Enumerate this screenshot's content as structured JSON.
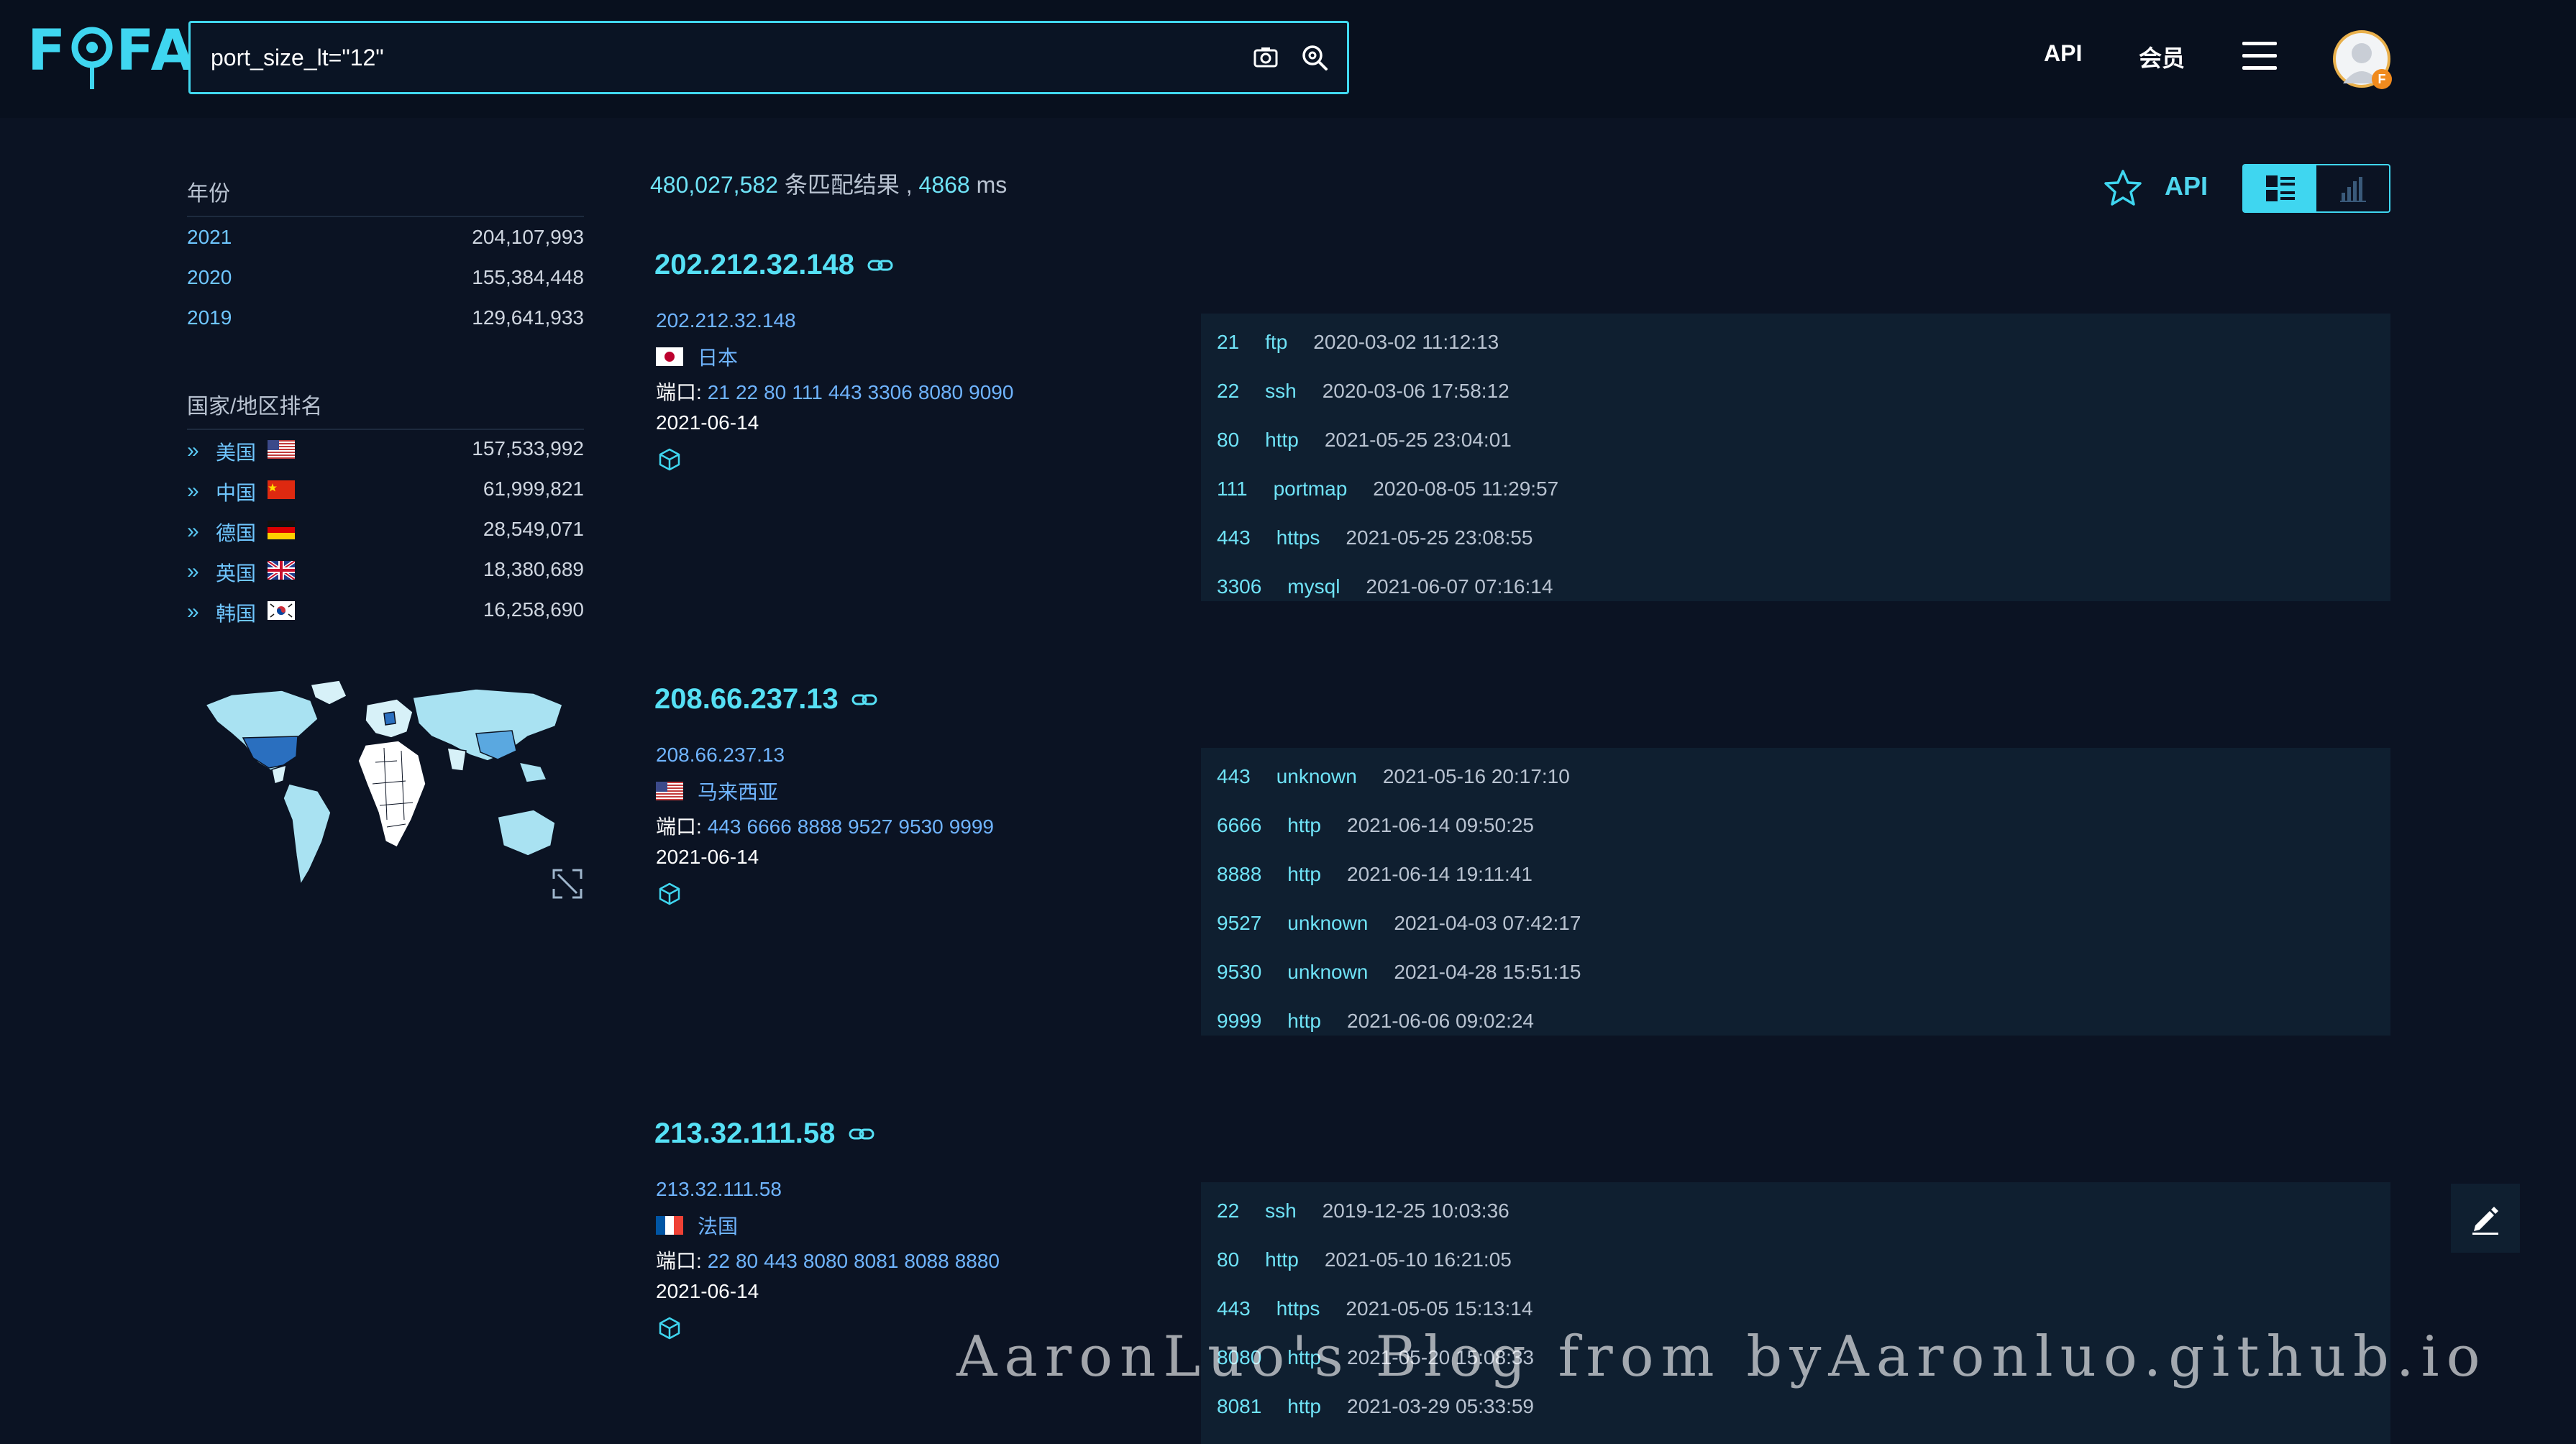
{
  "header": {
    "logo_text": "FOFA",
    "search_value": "port_size_lt=\"12\"",
    "nav_api": "API",
    "nav_member": "会员",
    "avatar_badge": "F"
  },
  "sidebar": {
    "year_heading": "年份",
    "years": [
      {
        "label": "2021",
        "count": "204,107,993"
      },
      {
        "label": "2020",
        "count": "155,384,448"
      },
      {
        "label": "2019",
        "count": "129,641,933"
      }
    ],
    "country_heading": "国家/地区排名",
    "countries": [
      {
        "label": "美国",
        "flag": "us-flag",
        "count": "157,533,992"
      },
      {
        "label": "中国",
        "flag": "cn-flag",
        "count": "61,999,821"
      },
      {
        "label": "德国",
        "flag": "de-flag",
        "count": "28,549,071"
      },
      {
        "label": "英国",
        "flag": "gb-flag",
        "count": "18,380,689"
      },
      {
        "label": "韩国",
        "flag": "kr-flag",
        "count": "16,258,690"
      }
    ]
  },
  "summary": {
    "count": "480,027,582",
    "count_suffix": " 条匹配结果 , ",
    "time": "4868",
    "time_unit": " ms"
  },
  "toolbar": {
    "api_label": "API"
  },
  "results": [
    {
      "title": "202.212.32.148",
      "ip": "202.212.32.148",
      "country": "日本",
      "flag": "jp-flag",
      "ports_label": "端口:",
      "ports": [
        "21",
        "22",
        "80",
        "111",
        "443",
        "3306",
        "8080",
        "9090"
      ],
      "date": "2021-06-14",
      "services": [
        {
          "port": "21",
          "protocol": "ftp",
          "time": "2020-03-02 11:12:13"
        },
        {
          "port": "22",
          "protocol": "ssh",
          "time": "2020-03-06 17:58:12"
        },
        {
          "port": "80",
          "protocol": "http",
          "time": "2021-05-25 23:04:01"
        },
        {
          "port": "111",
          "protocol": "portmap",
          "time": "2020-08-05 11:29:57"
        },
        {
          "port": "443",
          "protocol": "https",
          "time": "2021-05-25 23:08:55"
        },
        {
          "port": "3306",
          "protocol": "mysql",
          "time": "2021-06-07 07:16:14"
        }
      ]
    },
    {
      "title": "208.66.237.13",
      "ip": "208.66.237.13",
      "country": "马来西亚",
      "flag": "us-flag",
      "ports_label": "端口:",
      "ports": [
        "443",
        "6666",
        "8888",
        "9527",
        "9530",
        "9999"
      ],
      "date": "2021-06-14",
      "services": [
        {
          "port": "443",
          "protocol": "unknown",
          "time": "2021-05-16 20:17:10"
        },
        {
          "port": "6666",
          "protocol": "http",
          "time": "2021-06-14 09:50:25"
        },
        {
          "port": "8888",
          "protocol": "http",
          "time": "2021-06-14 19:11:41"
        },
        {
          "port": "9527",
          "protocol": "unknown",
          "time": "2021-04-03 07:42:17"
        },
        {
          "port": "9530",
          "protocol": "unknown",
          "time": "2021-04-28 15:51:15"
        },
        {
          "port": "9999",
          "protocol": "http",
          "time": "2021-06-06 09:02:24"
        }
      ]
    },
    {
      "title": "213.32.111.58",
      "ip": "213.32.111.58",
      "country": "法国",
      "flag": "fr-flag",
      "ports_label": "端口:",
      "ports": [
        "22",
        "80",
        "443",
        "8080",
        "8081",
        "8088",
        "8880"
      ],
      "date": "2021-06-14",
      "services": [
        {
          "port": "22",
          "protocol": "ssh",
          "time": "2019-12-25 10:03:36"
        },
        {
          "port": "80",
          "protocol": "http",
          "time": "2021-05-10 16:21:05"
        },
        {
          "port": "443",
          "protocol": "https",
          "time": "2021-05-05 15:13:14"
        },
        {
          "port": "8080",
          "protocol": "http",
          "time": "2021-05-20 15:08:33"
        },
        {
          "port": "8081",
          "protocol": "http",
          "time": "2021-03-29 05:33:59"
        }
      ]
    }
  ],
  "watermark": "AaronLuo's Blog from byAaronluo.github.io",
  "colors": {
    "accent": "#3fd6f0",
    "background": "#0b1323",
    "panel": "#0f1f30",
    "link": "#6fb4ff"
  }
}
